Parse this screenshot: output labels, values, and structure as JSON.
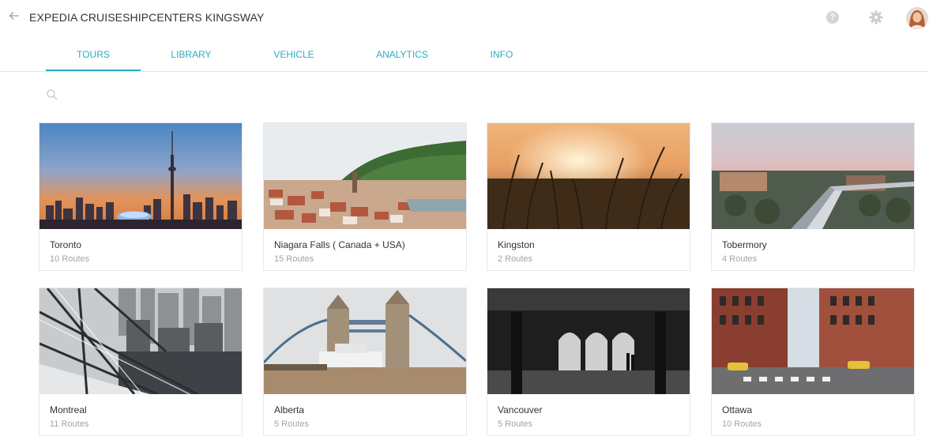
{
  "header": {
    "title": "EXPEDIA CRUISESHIPCENTERS KINGSWAY",
    "help_glyph": "?"
  },
  "tabs": [
    {
      "label": "TOURS",
      "active": true
    },
    {
      "label": "LIBRARY",
      "active": false
    },
    {
      "label": "VEHICLE",
      "active": false
    },
    {
      "label": "ANALYTICS",
      "active": false
    },
    {
      "label": "INFO",
      "active": false
    }
  ],
  "icons": {
    "back": "back-arrow-icon",
    "search": "search-icon",
    "help": "help-icon",
    "settings": "gear-icon"
  },
  "colors": {
    "accent": "#2aaec1",
    "muted_text": "#a0a4a8"
  },
  "tours": [
    {
      "name": "Toronto",
      "routes": "10 Routes"
    },
    {
      "name": "Niagara Falls ( Canada + USA)",
      "routes": "15 Routes"
    },
    {
      "name": "Kingston",
      "routes": "2 Routes"
    },
    {
      "name": "Tobermory",
      "routes": "4 Routes"
    },
    {
      "name": "Montreal",
      "routes": "11 Routes"
    },
    {
      "name": "Alberta",
      "routes": "5 Routes"
    },
    {
      "name": "Vancouver",
      "routes": "5 Routes"
    },
    {
      "name": "Ottawa",
      "routes": "10 Routes"
    }
  ]
}
